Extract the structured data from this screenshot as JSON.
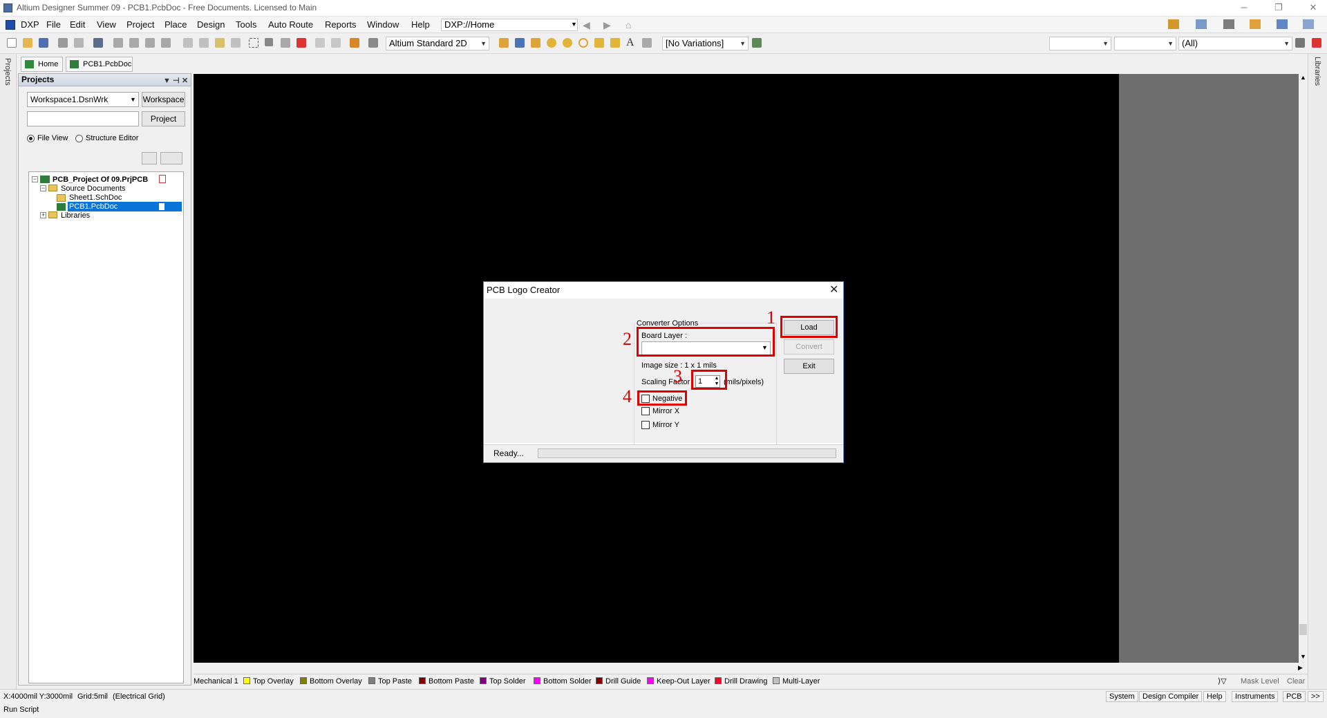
{
  "window": {
    "title": "Altium Designer Summer 09 - PCB1.PcbDoc - Free Documents. Licensed to Main"
  },
  "menu": {
    "items": [
      "DXP",
      "File",
      "Edit",
      "View",
      "Project",
      "Place",
      "Design",
      "Tools",
      "Auto Route",
      "Reports",
      "Window",
      "Help"
    ],
    "address": "DXP://Home"
  },
  "toolbar": {
    "view_mode": "Altium Standard 2D",
    "variations": "[No Variations]",
    "filter_all": "(All)"
  },
  "tabs": [
    "Home",
    "PCB1.PcbDoc"
  ],
  "side_labels": {
    "left": "Projects",
    "right": "Libraries"
  },
  "projects_panel": {
    "title": "Projects",
    "workspace_value": "Workspace1.DsnWrk",
    "workspace_button": "Workspace",
    "project_input": "",
    "project_button": "Project",
    "view_options": [
      "File View",
      "Structure Editor"
    ],
    "tree": {
      "project": "PCB_Project Of 09.PrjPCB",
      "source_folder": "Source Documents",
      "documents": [
        "Sheet1.SchDoc",
        "PCB1.PcbDoc"
      ],
      "libraries": "Libraries"
    }
  },
  "dialog": {
    "title": "PCB Logo Creator",
    "group_label": "Converter Options",
    "board_layer_label": "Board Layer :",
    "board_layer_value": "",
    "image_size": "Image size : 1 x 1 mils",
    "scaling_label": "Scaling Factor",
    "scaling_value": "1",
    "scaling_unit": "(mils/pixels)",
    "checkboxes": [
      "Negative",
      "Mirror X",
      "Mirror Y"
    ],
    "buttons": {
      "load": "Load",
      "convert": "Convert",
      "exit": "Exit"
    },
    "status": "Ready...",
    "annotations": [
      "1",
      "2",
      "3",
      "4"
    ]
  },
  "layers": [
    {
      "name": "Mechanical 1",
      "color": "#c0c0c0"
    },
    {
      "name": "Top Overlay",
      "color": "#ffff00"
    },
    {
      "name": "Bottom Overlay",
      "color": "#808000"
    },
    {
      "name": "Top Paste",
      "color": "#808080"
    },
    {
      "name": "Bottom Paste",
      "color": "#800000"
    },
    {
      "name": "Top Solder",
      "color": "#800080"
    },
    {
      "name": "Bottom Solder",
      "color": "#ff00ff"
    },
    {
      "name": "Drill Guide",
      "color": "#800000"
    },
    {
      "name": "Keep-Out Layer",
      "color": "#ff00ff"
    },
    {
      "name": "Drill Drawing",
      "color": "#ff002a"
    },
    {
      "name": "Multi-Layer",
      "color": "#c0c0c0"
    }
  ],
  "layer_tools": {
    "mask_level": "Mask Level",
    "clear": "Clear"
  },
  "status": {
    "coords": "X:4000mil Y:3000mil",
    "grid": "Grid:5mil",
    "grid_type": "(Electrical Grid)",
    "run_script": "Run Script",
    "panels": [
      "System",
      "Design Compiler",
      "Help",
      "Instruments",
      "PCB",
      ">>"
    ]
  }
}
